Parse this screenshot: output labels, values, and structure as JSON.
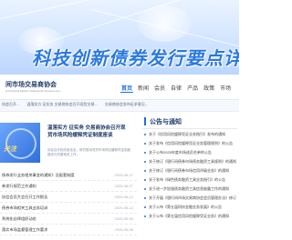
{
  "hero": {
    "title": "科技创新债券发行要点详解"
  },
  "header": {
    "org_name": "间市场交易商协会",
    "org_sub": "al Financial Market Institutional Investors Ass..."
  },
  "nav": {
    "items": [
      {
        "label": "首页",
        "active": true
      },
      {
        "label": "新闻",
        "active": false
      },
      {
        "label": "会员",
        "active": false
      },
      {
        "label": "自律",
        "active": false
      },
      {
        "label": "产品",
        "active": false
      },
      {
        "label": "政策",
        "active": false
      },
      {
        "label": "市场",
        "active": false
      }
    ]
  },
  "ticker": {
    "items": [
      "协会召开...",
      "温落实方 征实务 交易商协会召开现货交易...",
      "交易商协会发布征求意见..."
    ]
  },
  "feature": {
    "thumb_text": "关注",
    "title": "温落实方 征实务 交易商协会召开现货市场风险缓释凭证制度座谈",
    "desc": "协会召开相关座谈会，研究推动现货市场风险缓释凭证制度建设与完善相关工作。"
  },
  "news": {
    "items": [
      {
        "title": "债券发行业务相关事宜的通知》及配套制度",
        "date": "2025-06-27"
      },
      {
        "title": "券发行规范工作通知",
        "date": "2025-06-27"
      },
      {
        "title": "协会会员大会召开工作报告",
        "date": "2025-06-12"
      },
      {
        "title": "债券市场相关工具业务培训",
        "date": "2025-05-14"
      },
      {
        "title": "系统化自律组织动态",
        "date": "2025-05-09"
      },
      {
        "title": "落实市场监督管理工作要求",
        "date": "2025-05-06"
      }
    ]
  },
  "right": {
    "title": "公告与通知",
    "items": [
      "关于《信用风险缓释凭证业务指引》发布的通知",
      "关于发布《信用风险缓释凭证业务管理规则》的公告",
      "关于公布2025年度市场成员名单的公告",
      "关于修订《银行间债券市场债务融资工具规则》的通知",
      "关于修订《银行间债券市场信用评级业务》的通知",
      "关于发布《绿色债务融资工具业务指引》的公告",
      "关于进一步加强债务融资工具信息披露工作的通知",
      "关于开展《银行间市场交易商协会会员管理办法》修订的通知",
      "关于公布《第五届科技金融业务发展》的公告",
      "关于公布《第五届信用风险缓释凭证业务》的通知"
    ]
  },
  "colors": {
    "accent": "#1e6fd9",
    "hero_title": "#2a79e0",
    "org_navy": "#1f3d6b"
  }
}
